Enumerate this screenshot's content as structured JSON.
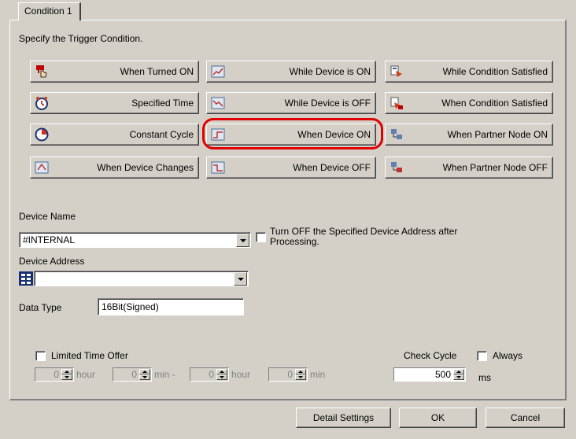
{
  "tab": {
    "label": "Condition 1"
  },
  "instruction": "Specify the Trigger Condition.",
  "trigger_buttons": [
    {
      "label": "When Turned ON",
      "icon": "hand-switch-icon"
    },
    {
      "label": "While Device is ON",
      "icon": "device-on-icon"
    },
    {
      "label": "While Condition Satisfied",
      "icon": "condition-icon"
    },
    {
      "label": "Specified Time",
      "icon": "alarm-clock-icon"
    },
    {
      "label": "While Device is OFF",
      "icon": "device-off-icon"
    },
    {
      "label": "When Condition Satisfied",
      "icon": "condition-ok-icon"
    },
    {
      "label": "Constant Cycle",
      "icon": "clock-icon"
    },
    {
      "label": "When Device ON",
      "icon": "device-rise-icon"
    },
    {
      "label": "When Partner Node ON",
      "icon": "partner-node-icon"
    },
    {
      "label": "When Device Changes",
      "icon": "device-change-icon"
    },
    {
      "label": "When Device OFF",
      "icon": "device-fall-icon"
    },
    {
      "label": "When Partner Node OFF",
      "icon": "partner-node-off-icon"
    }
  ],
  "device_name": {
    "label": "Device Name",
    "value": "#INTERNAL"
  },
  "turn_off": {
    "label": "Turn OFF the Specified Device Address after Processing."
  },
  "device_address": {
    "label": "Device Address",
    "value": ""
  },
  "data_type": {
    "label": "Data Type",
    "value": "16Bit(Signed)"
  },
  "limited_time": {
    "label": "Limited Time Offer",
    "fields": [
      {
        "value": "0",
        "unit": "hour"
      },
      {
        "value": "0",
        "unit": "min -"
      },
      {
        "value": "0",
        "unit": "hour"
      },
      {
        "value": "0",
        "unit": "min"
      }
    ]
  },
  "check_cycle": {
    "label": "Check Cycle",
    "always_label": "Always",
    "value": "500",
    "unit": "ms"
  },
  "footer": {
    "detail": "Detail Settings",
    "ok": "OK",
    "cancel": "Cancel"
  },
  "colors": {
    "highlight": "#e00000",
    "face": "#d4d0c8"
  }
}
